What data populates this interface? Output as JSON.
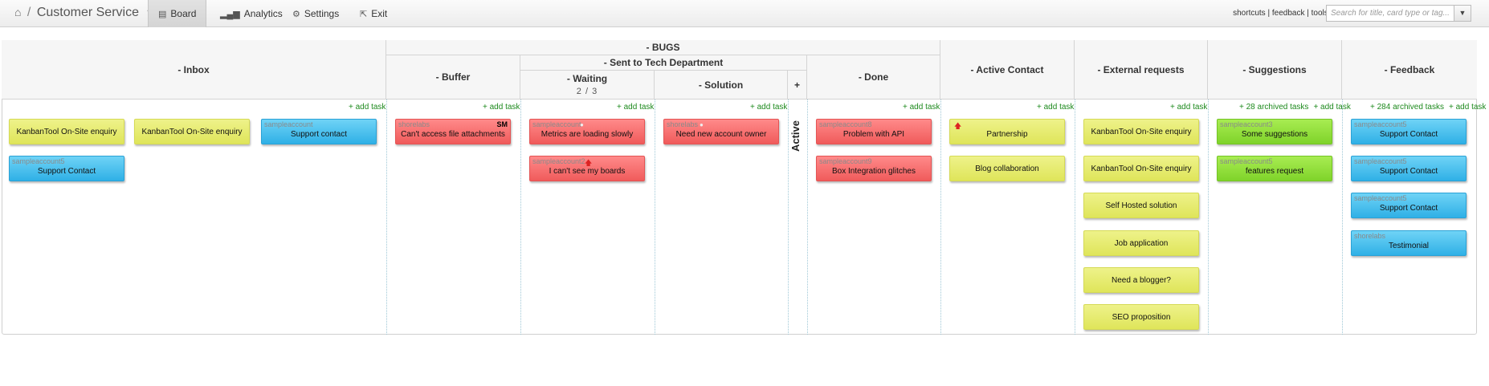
{
  "topbar": {
    "board_name": "Customer Service",
    "home_icon": "home-icon",
    "nav": [
      {
        "label": "Board",
        "icon": "board-icon"
      },
      {
        "label": "Analytics",
        "icon": "analytics-icon"
      },
      {
        "label": "Settings",
        "icon": "gear-icon"
      },
      {
        "label": "Exit",
        "icon": "exit-icon"
      }
    ],
    "links": {
      "shortcuts": "shortcuts",
      "feedback": "feedback",
      "tools": "tools"
    },
    "search_placeholder": "Search for title, card type or tag..."
  },
  "board": {
    "headers": {
      "bugs": "- BUGS",
      "sent_to_tech": "- Sent to Tech Department",
      "inbox": "- Inbox",
      "buffer": "- Buffer",
      "waiting": "- Waiting",
      "waiting_limit": "2 / 3",
      "solution": "- Solution",
      "plus": "+",
      "done": "- Done",
      "active_contact": "- Active Contact",
      "external_requests": "- External requests",
      "suggestions": "- Suggestions",
      "feedback": "- Feedback"
    },
    "active_label": "Active",
    "add_task": "+ add task",
    "archived": {
      "suggestions": "+ 28 archived tasks",
      "feedback": "+ 284 archived tasks"
    },
    "cards": {
      "inbox": [
        {
          "title": "KanbanTool On-Site enquiry",
          "owner": ""
        },
        {
          "title": "KanbanTool On-Site enquiry",
          "owner": ""
        },
        {
          "title": "Support contact",
          "owner": "sampleaccount"
        },
        {
          "title": "Support Contact",
          "owner": "sampleaccount5"
        }
      ],
      "buffer": [
        {
          "title": "Can't access file attachments",
          "owner": "shorelabs",
          "tag": "SM"
        }
      ],
      "waiting": [
        {
          "title": "Metrics are loading slowly",
          "owner": "sampleaccount"
        },
        {
          "title": "I can't see my boards",
          "owner": "sampleaccount2"
        }
      ],
      "solution": [
        {
          "title": "Need new account owner",
          "owner": "shorelabs"
        }
      ],
      "done": [
        {
          "title": "Problem with API",
          "owner": "sampleaccount8"
        },
        {
          "title": "Box Integration glitches",
          "owner": "sampleaccount9"
        }
      ],
      "active_contact": [
        {
          "title": "Partnership"
        },
        {
          "title": "Blog collaboration"
        }
      ],
      "external_requests": [
        {
          "title": "KanbanTool On-Site enquiry"
        },
        {
          "title": "KanbanTool On-Site enquiry"
        },
        {
          "title": "Self Hosted solution"
        },
        {
          "title": "Job application"
        },
        {
          "title": "Need a blogger?"
        },
        {
          "title": "SEO proposition"
        }
      ],
      "suggestions": [
        {
          "title": "Some suggestions",
          "owner": "sampleaccount3"
        },
        {
          "title": "features request",
          "owner": "sampleaccount5"
        }
      ],
      "feedback": [
        {
          "title": "Support Contact",
          "owner": "sampleaccount5"
        },
        {
          "title": "Support Contact",
          "owner": "sampleaccount5"
        },
        {
          "title": "Support Contact",
          "owner": "sampleaccount5"
        },
        {
          "title": "Testimonial",
          "owner": "shorelabs"
        }
      ]
    },
    "colors": {
      "yellow": "#e6eb6e",
      "blue": "#3fb9ea",
      "red": "#f46a6a",
      "green": "#8edc3a",
      "add_task": "#1e8a1e"
    }
  }
}
